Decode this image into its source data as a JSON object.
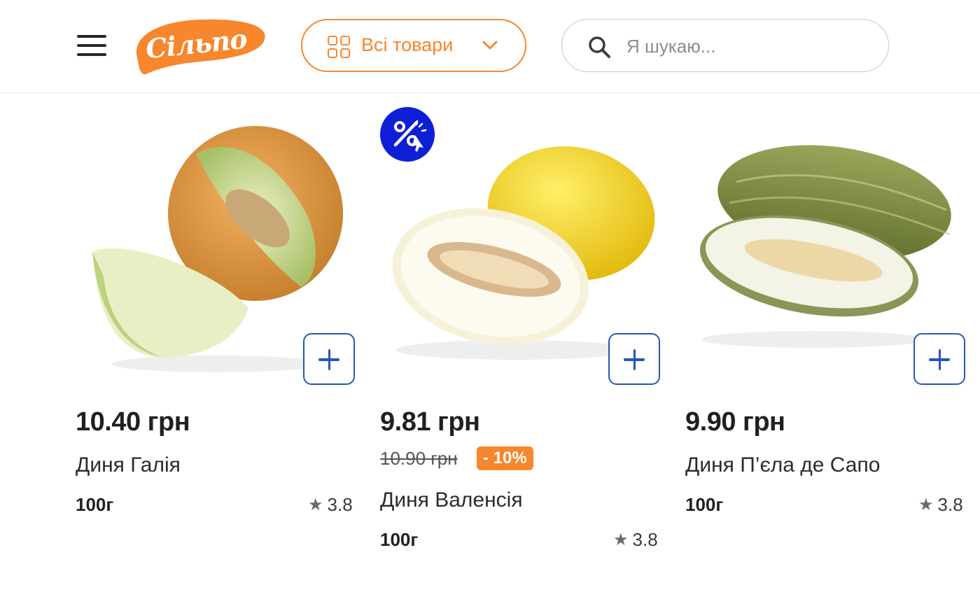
{
  "header": {
    "logo_text": "Сільпо",
    "catalog_label": "Всі товари",
    "search_placeholder": "Я шукаю..."
  },
  "colors": {
    "brand_orange": "#f7862c",
    "accent_blue": "#2a55b8",
    "promo_blue": "#0f1fd6"
  },
  "products": [
    {
      "price": "10.40 грн",
      "name": "Диня Галія",
      "weight": "100г",
      "rating": "3.8"
    },
    {
      "price": "9.81 грн",
      "old_price": "10.90 грн",
      "discount": "- 10%",
      "name": "Диня Валенсія",
      "weight": "100г",
      "rating": "3.8",
      "promo_icon": "percent-cursor-icon"
    },
    {
      "price": "9.90 грн",
      "name": "Диня П’єла де Сапо",
      "weight": "100г",
      "rating": "3.8"
    }
  ]
}
